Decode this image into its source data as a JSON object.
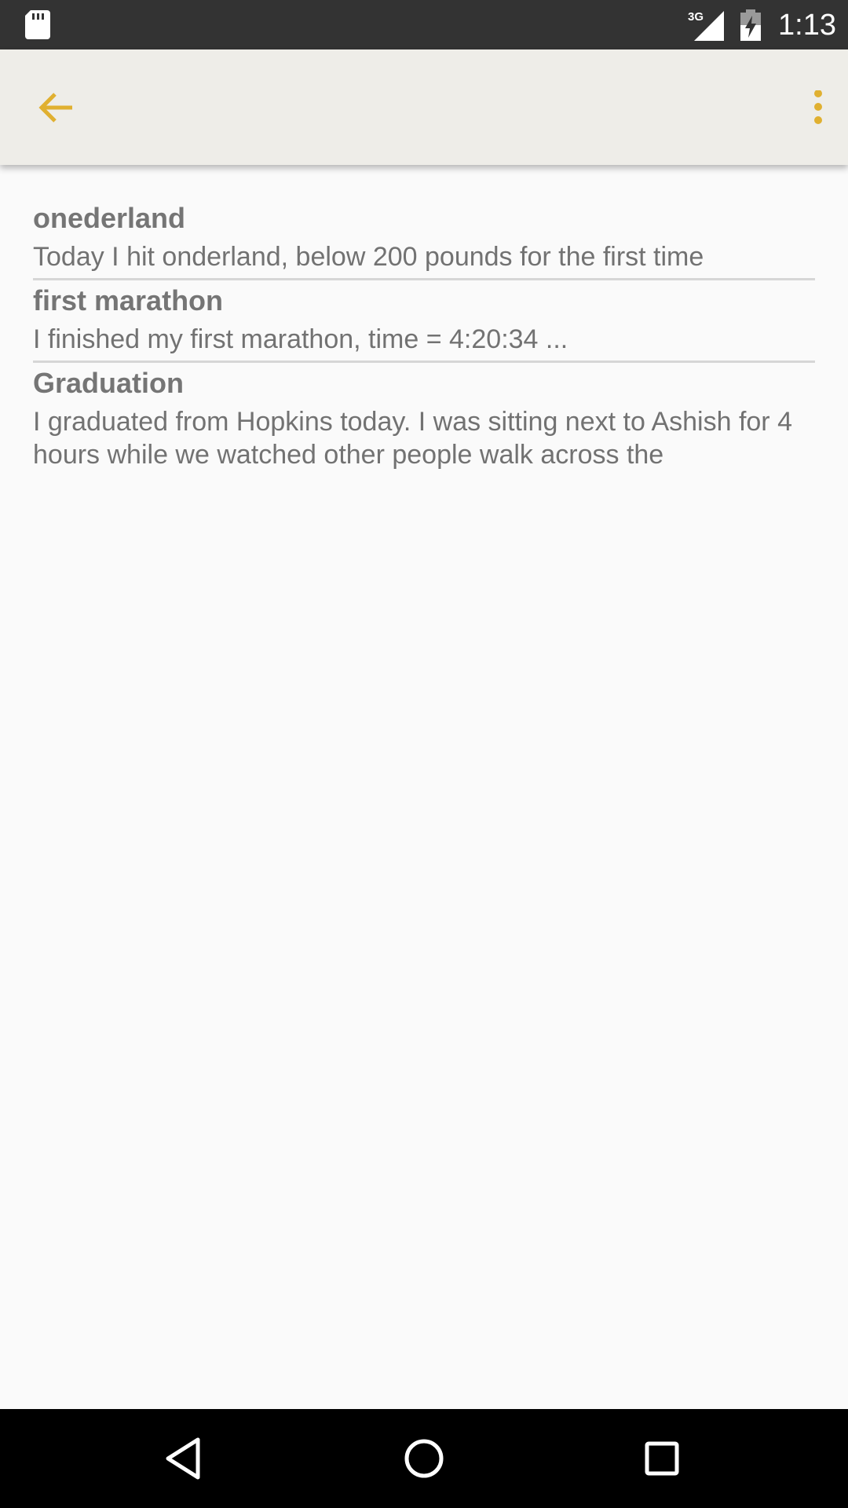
{
  "status_bar": {
    "time": "1:13",
    "network": "3G",
    "icons": [
      "sd-card-icon",
      "signal-icon",
      "battery-charging-icon"
    ]
  },
  "app_bar": {
    "accent_color": "#e0b030",
    "icons": [
      "back-arrow-icon",
      "overflow-menu-icon"
    ]
  },
  "entries": [
    {
      "title": "onederland",
      "body": "Today I hit onderland, below 200 pounds for the first time"
    },
    {
      "title": "first marathon",
      "body": "I finished my first marathon, time = 4:20:34 ..."
    },
    {
      "title": "Graduation",
      "body": "I graduated from Hopkins today. I was sitting next to Ashish for 4 hours while we watched other people walk across the"
    }
  ],
  "nav_bar": {
    "icons": [
      "back-triangle-icon",
      "home-circle-icon",
      "recents-square-icon"
    ]
  }
}
